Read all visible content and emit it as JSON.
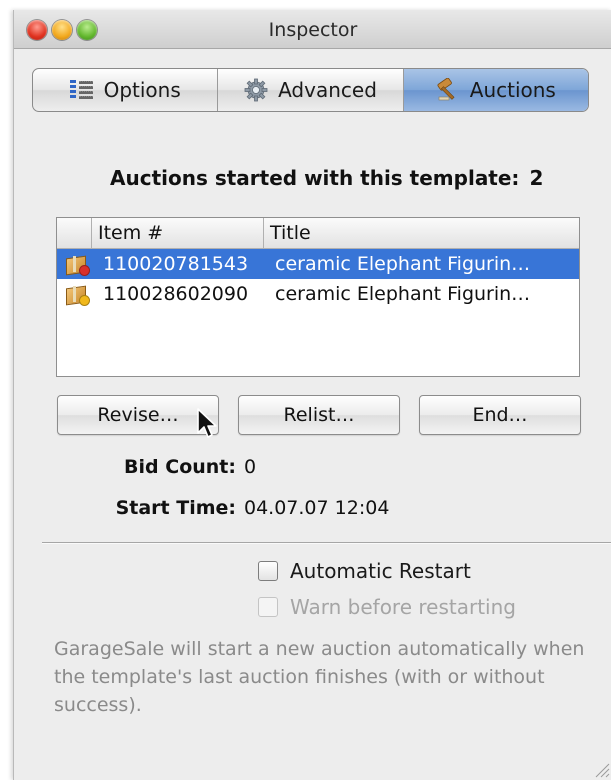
{
  "window": {
    "title": "Inspector"
  },
  "tabs": [
    {
      "label": "Options",
      "icon": "options-list-icon",
      "selected": false
    },
    {
      "label": "Advanced",
      "icon": "gear-icon",
      "selected": false
    },
    {
      "label": "Auctions",
      "icon": "gavel-icon",
      "selected": true
    }
  ],
  "auctions_summary": {
    "label": "Auctions started with this template:",
    "count": "2"
  },
  "table": {
    "columns": [
      "Item #",
      "Title"
    ],
    "rows": [
      {
        "item": "110020781543",
        "title": "ceramic Elephant Figurin…",
        "status_color": "#d9302a",
        "selected": true
      },
      {
        "item": "110028602090",
        "title": "ceramic Elephant Figurin…",
        "status_color": "#f1b81b",
        "selected": false
      }
    ]
  },
  "buttons": {
    "revise": "Revise…",
    "relist": "Relist…",
    "end": "End…"
  },
  "details": {
    "bid_count_label": "Bid Count:",
    "bid_count_value": "0",
    "start_time_label": "Start Time:",
    "start_time_value": "04.07.07 12:04"
  },
  "options": {
    "automatic_restart": {
      "label": "Automatic Restart",
      "checked": false,
      "enabled": true
    },
    "warn_before_restarting": {
      "label": "Warn before restarting",
      "checked": false,
      "enabled": false
    }
  },
  "note": "GarageSale will start a new auction automatically when the template's last auction finishes (with or without success).",
  "colors": {
    "selection": "#3875d7",
    "selected_tab": "#7ea6d8"
  }
}
